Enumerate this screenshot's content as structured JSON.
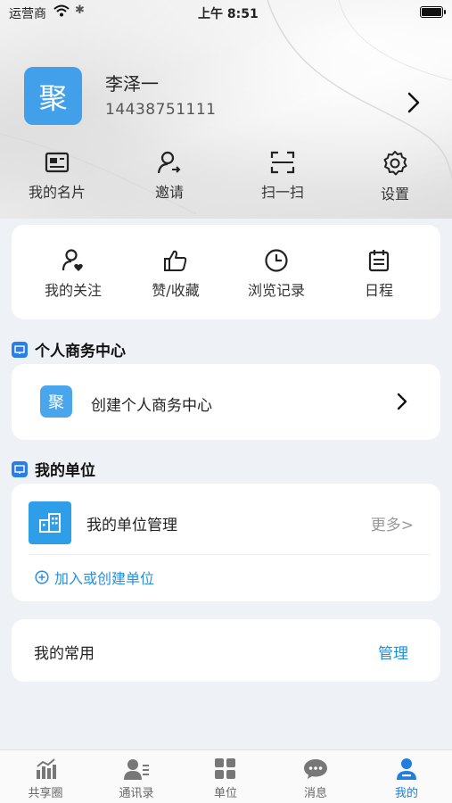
{
  "status_bar": {
    "carrier": "运营商",
    "time": "上午 8:51"
  },
  "profile": {
    "avatar_char": "聚",
    "name": "李泽一",
    "phone": "14438751111"
  },
  "quick_actions": [
    {
      "label": "我的名片",
      "icon": "business-card-icon"
    },
    {
      "label": "邀请",
      "icon": "invite-user-icon"
    },
    {
      "label": "扫一扫",
      "icon": "scan-icon"
    },
    {
      "label": "设置",
      "icon": "gear-icon"
    }
  ],
  "favorites": [
    {
      "label": "我的关注",
      "icon": "follow-user-icon"
    },
    {
      "label": "赞/收藏",
      "icon": "thumbs-up-icon"
    },
    {
      "label": "浏览记录",
      "icon": "clock-icon"
    },
    {
      "label": "日程",
      "icon": "calendar-icon"
    }
  ],
  "personal_business": {
    "section_title": "个人商务中心",
    "logo_char": "聚",
    "create_label": "创建个人商务中心"
  },
  "my_unit": {
    "section_title": "我的单位",
    "manage_label": "我的单位管理",
    "more_label": "更多>",
    "join_label": "加入或创建单位"
  },
  "common": {
    "label": "我的常用",
    "manage_label": "管理"
  },
  "tabbar": [
    {
      "label": "共享圈",
      "icon": "share-circle-icon",
      "active": false
    },
    {
      "label": "通讯录",
      "icon": "contacts-icon",
      "active": false
    },
    {
      "label": "单位",
      "icon": "grid-icon",
      "active": false
    },
    {
      "label": "消息",
      "icon": "message-icon",
      "active": false
    },
    {
      "label": "我的",
      "icon": "profile-icon",
      "active": true
    }
  ],
  "colors": {
    "accent": "#1f7fe0",
    "avatar_bg": "#42a0ea",
    "page_bg": "#eef1f5"
  }
}
